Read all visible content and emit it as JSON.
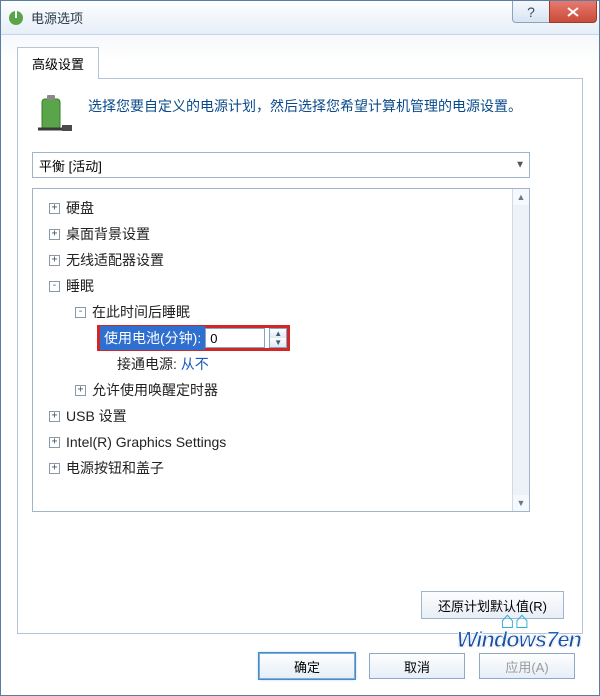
{
  "window": {
    "title": "电源选项"
  },
  "tab": {
    "label": "高级设置"
  },
  "intro": "选择您要自定义的电源计划，然后选择您希望计算机管理的电源设置。",
  "plan": {
    "selected": "平衡 [活动]"
  },
  "tree": {
    "hard_disk": "硬盘",
    "desktop_bg": "桌面背景设置",
    "wireless": "无线适配器设置",
    "sleep": "睡眠",
    "sleep_after": "在此时间后睡眠",
    "on_battery_label": "使用电池(分钟):",
    "on_battery_value": "0",
    "plugged_in_label": "接通电源:",
    "plugged_in_value": "从不",
    "allow_wake": "允许使用唤醒定时器",
    "usb": "USB 设置",
    "graphics": "Intel(R) Graphics Settings",
    "power_buttons": "电源按钮和盖子"
  },
  "restore_label": "还原计划默认值(R)",
  "buttons": {
    "ok": "确定",
    "cancel": "取消",
    "apply": "应用(A)"
  },
  "watermark": "Windows7en"
}
